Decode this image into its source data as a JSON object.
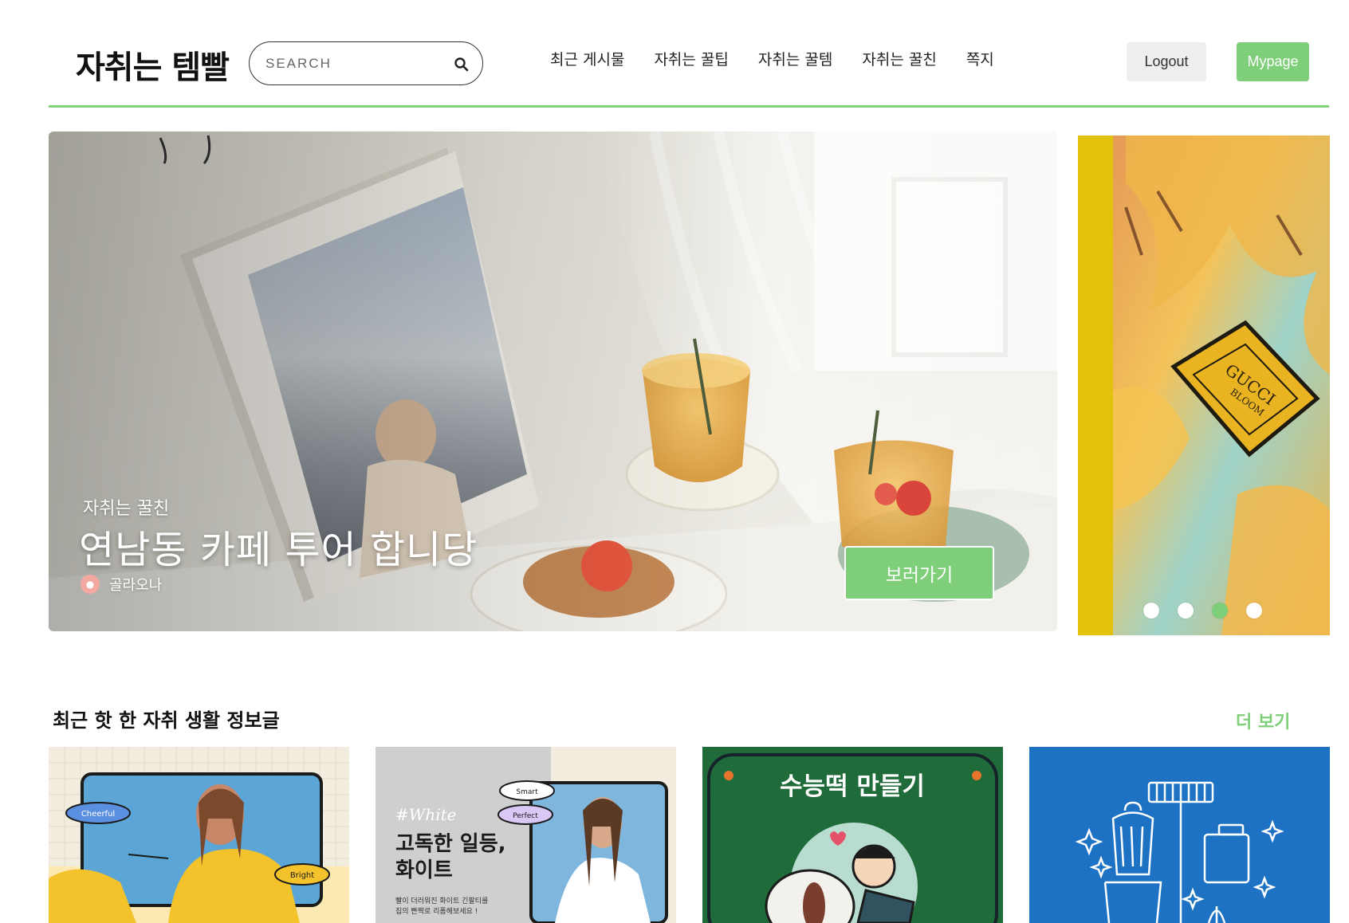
{
  "header": {
    "logo": "자취는 템빨",
    "search": {
      "placeholder": "SEARCH",
      "icon": "search-icon"
    },
    "nav": [
      {
        "label": "최근 게시물"
      },
      {
        "label": "자취는 꿀팁"
      },
      {
        "label": "자취는 꿀템"
      },
      {
        "label": "자취는 꿀친"
      },
      {
        "label": "쪽지"
      }
    ],
    "logout_label": "Logout",
    "mypage_label": "Mypage",
    "accent_color": "#7fcf7a"
  },
  "hero": {
    "category": "자취는 꿀친",
    "title": "연남동 카페 투어 합니당",
    "author": "골라오나",
    "button_label": "보러가기",
    "side_brand": "GUCCI",
    "side_brand_sub": "BLOOM",
    "slide_count": 4,
    "active_slide": 3
  },
  "section": {
    "title": "최근 핫 한 자취 생활 정보글",
    "more_label": "더 보기",
    "cards": [
      {
        "tags": [
          "Cheerful",
          "Bright"
        ]
      },
      {
        "hashtag": "#White",
        "title_line1": "고독한 일등,",
        "title_line2": "화이트",
        "desc_line1": "빨이 더러워진 화이트 긴팔티를",
        "desc_line2": "집의 빤짝로 리폼해보세요 !",
        "tags": [
          "Smart",
          "Perfect"
        ]
      },
      {
        "title": "수능떡 만들기"
      },
      {
        "icon": "cleaning-tools-icon"
      }
    ]
  }
}
